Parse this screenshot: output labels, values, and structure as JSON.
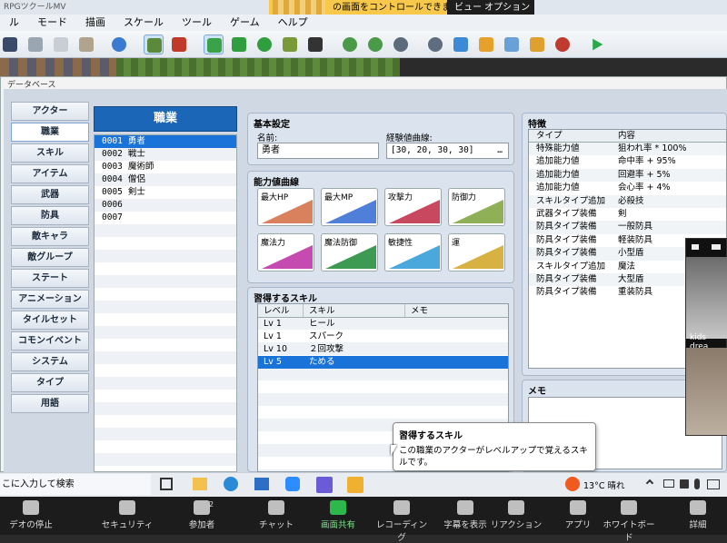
{
  "window_title": "RPGツクールMV",
  "zoom_banner": {
    "text": "の画面をコントロールできます",
    "view_options": "ビュー オプション ⌄"
  },
  "menu": [
    "ル",
    "モード",
    "描画",
    "スケール",
    "ツール",
    "ゲーム",
    "ヘルプ"
  ],
  "database_title": "データベース",
  "sidebar": [
    "アクター",
    "職業",
    "スキル",
    "アイテム",
    "武器",
    "防具",
    "敵キャラ",
    "敵グループ",
    "ステート",
    "アニメーション",
    "タイルセット",
    "コモンイベント",
    "システム",
    "タイプ",
    "用語"
  ],
  "active_sidebar": "職業",
  "class_list_header": "職業",
  "classes": [
    {
      "id": "0001",
      "name": "勇者"
    },
    {
      "id": "0002",
      "name": "戦士"
    },
    {
      "id": "0003",
      "name": "魔術師"
    },
    {
      "id": "0004",
      "name": "僧侶"
    },
    {
      "id": "0005",
      "name": "剣士"
    },
    {
      "id": "0006",
      "name": ""
    },
    {
      "id": "0007",
      "name": ""
    }
  ],
  "basic": {
    "title": "基本設定",
    "name_label": "名前:",
    "name_value": "勇者",
    "exp_label": "経験値曲線:",
    "exp_value": "[30, 20, 30, 30]",
    "exp_button": "…"
  },
  "params": {
    "title": "能力値曲線",
    "items": [
      {
        "label": "最大HP",
        "color": "#d9805c"
      },
      {
        "label": "最大MP",
        "color": "#4f7fd9"
      },
      {
        "label": "攻撃力",
        "color": "#c8485f"
      },
      {
        "label": "防御力",
        "color": "#8fb057"
      },
      {
        "label": "魔法力",
        "color": "#c54bb0"
      },
      {
        "label": "魔法防御",
        "color": "#3c9a52"
      },
      {
        "label": "敏捷性",
        "color": "#4aa8dd"
      },
      {
        "label": "運",
        "color": "#d7b243"
      }
    ]
  },
  "skills": {
    "title": "習得するスキル",
    "headers": [
      "レベル",
      "スキル",
      "メモ"
    ],
    "rows": [
      {
        "level": "Lv  1",
        "skill": "ヒール",
        "memo": ""
      },
      {
        "level": "Lv  1",
        "skill": "スパーク",
        "memo": ""
      },
      {
        "level": "Lv 10",
        "skill": "２回攻撃",
        "memo": ""
      },
      {
        "level": "Lv  5",
        "skill": "ためる",
        "memo": ""
      }
    ]
  },
  "traits": {
    "title": "特徴",
    "headers": [
      "タイプ",
      "内容"
    ],
    "rows": [
      [
        "特殊能力値",
        "狙われ率 * 100%"
      ],
      [
        "追加能力値",
        "命中率 + 95%"
      ],
      [
        "追加能力値",
        "回避率 + 5%"
      ],
      [
        "追加能力値",
        "会心率 + 4%"
      ],
      [
        "スキルタイプ追加",
        "必殺技"
      ],
      [
        "武器タイプ装備",
        "剣"
      ],
      [
        "防具タイプ装備",
        "一般防具"
      ],
      [
        "防具タイプ装備",
        "軽装防具"
      ],
      [
        "防具タイプ装備",
        "小型盾"
      ],
      [
        "スキルタイプ追加",
        "魔法"
      ],
      [
        "防具タイプ装備",
        "大型盾"
      ],
      [
        "防具タイプ装備",
        "重装防具"
      ]
    ]
  },
  "memo_title": "メモ",
  "tooltip": {
    "title": "習得するスキル",
    "body": "この職業のアクターがレベルアップで覚えるスキルです。"
  },
  "video_label": "kids drea",
  "taskbar": {
    "search": "こに入力して検索",
    "weather": "13°C 晴れ"
  },
  "zoombar": [
    {
      "label": "デオの停止",
      "icon": "camera-icon"
    },
    {
      "label": "セキュリティ",
      "icon": "shield-icon"
    },
    {
      "label": "参加者",
      "icon": "people-icon",
      "badge": "2"
    },
    {
      "label": "チャット",
      "icon": "chat-icon"
    },
    {
      "label": "画面共有",
      "icon": "share-icon"
    },
    {
      "label": "レコーディング",
      "icon": "record-icon"
    },
    {
      "label": "字幕を表示",
      "icon": "cc-icon"
    },
    {
      "label": "リアクション",
      "icon": "smile-icon"
    },
    {
      "label": "アプリ",
      "icon": "apps-icon"
    },
    {
      "label": "ホワイトボード",
      "icon": "whiteboard-icon"
    },
    {
      "label": "詳細",
      "icon": "more-icon"
    }
  ]
}
